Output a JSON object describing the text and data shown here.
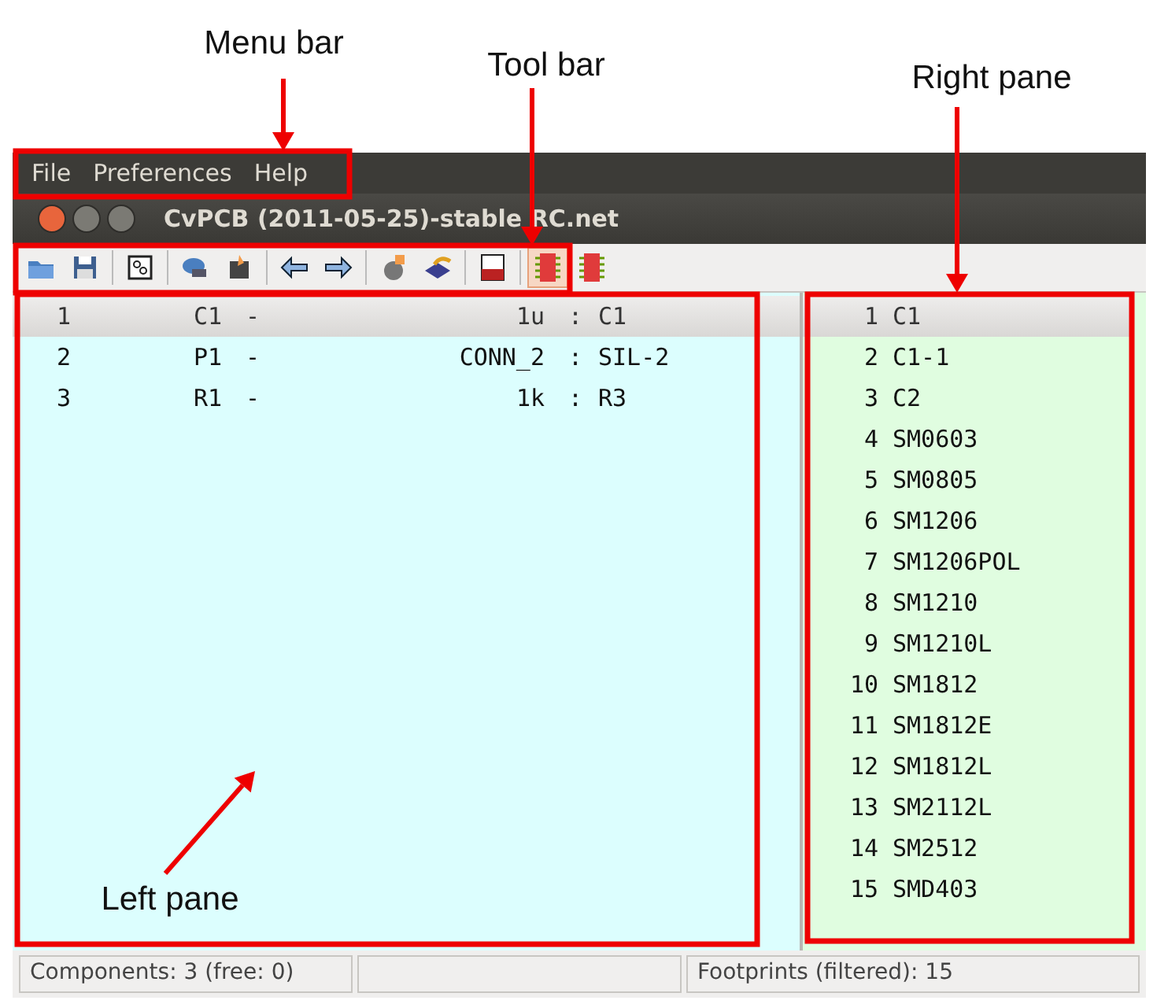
{
  "annotations": [
    {
      "label": "Menu bar"
    },
    {
      "label": "Tool bar"
    },
    {
      "label": "Right pane"
    },
    {
      "label": "Left pane"
    }
  ],
  "menu_bar": {
    "items": [
      "File",
      "Preferences",
      "Help"
    ]
  },
  "window": {
    "title": "CvPCB (2011-05-25)-stable RC.net"
  },
  "toolbar": {
    "toggles": [
      {
        "selected": true
      },
      {
        "selected": false
      }
    ]
  },
  "components": [
    {
      "number": "1",
      "reference": "C1",
      "separator": "-",
      "value": "1u",
      "colon": ":",
      "footprint": "C1",
      "selected": true
    },
    {
      "number": "2",
      "reference": "P1",
      "separator": "-",
      "value": "CONN_2",
      "colon": ":",
      "footprint": "SIL-2",
      "selected": false
    },
    {
      "number": "3",
      "reference": "R1",
      "separator": "-",
      "value": "1k",
      "colon": ":",
      "footprint": "R3",
      "selected": false
    }
  ],
  "footprints": [
    {
      "number": "1",
      "name": "C1",
      "selected": true
    },
    {
      "number": "2",
      "name": "C1-1",
      "selected": false
    },
    {
      "number": "3",
      "name": "C2",
      "selected": false
    },
    {
      "number": "4",
      "name": "SM0603",
      "selected": false
    },
    {
      "number": "5",
      "name": "SM0805",
      "selected": false
    },
    {
      "number": "6",
      "name": "SM1206",
      "selected": false
    },
    {
      "number": "7",
      "name": "SM1206POL",
      "selected": false
    },
    {
      "number": "8",
      "name": "SM1210",
      "selected": false
    },
    {
      "number": "9",
      "name": "SM1210L",
      "selected": false
    },
    {
      "number": "10",
      "name": "SM1812",
      "selected": false
    },
    {
      "number": "11",
      "name": "SM1812E",
      "selected": false
    },
    {
      "number": "12",
      "name": "SM1812L",
      "selected": false
    },
    {
      "number": "13",
      "name": "SM2112L",
      "selected": false
    },
    {
      "number": "14",
      "name": "SM2512",
      "selected": false
    },
    {
      "number": "15",
      "name": "SMD403",
      "selected": false
    }
  ],
  "status_bar": {
    "components": "Components: 3 (free: 0)",
    "footprints": "Footprints (filtered): 15"
  }
}
